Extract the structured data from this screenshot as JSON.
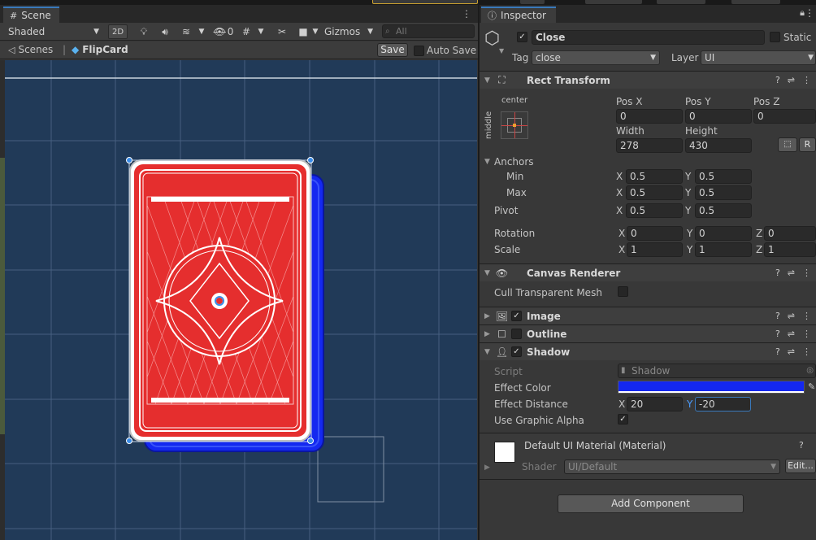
{
  "scene": {
    "tab_label": "Scene",
    "toolbar": {
      "shading_mode": "Shaded",
      "mode_2d": "2D",
      "hidden_count": "0",
      "gizmos_label": "Gizmos",
      "search_placeholder": "All"
    },
    "breadcrumb": {
      "scenes_label": "Scenes",
      "prefab_name": "FlipCard",
      "save_label": "Save",
      "auto_save_label": "Auto Save"
    }
  },
  "inspector": {
    "tab_label": "Inspector",
    "object": {
      "active": true,
      "name": "Close",
      "static_label": "Static",
      "tag_label": "Tag",
      "tag_value": "close",
      "layer_label": "Layer",
      "layer_value": "UI"
    },
    "rect_transform": {
      "title": "Rect Transform",
      "anchor_preset_h": "center",
      "anchor_preset_v": "middle",
      "pos_x_label": "Pos X",
      "pos_y_label": "Pos Y",
      "pos_z_label": "Pos Z",
      "pos_x": "0",
      "pos_y": "0",
      "pos_z": "0",
      "width_label": "Width",
      "height_label": "Height",
      "width": "278",
      "height": "430",
      "r_button": "R",
      "anchors_label": "Anchors",
      "min_label": "Min",
      "max_label": "Max",
      "pivot_label": "Pivot",
      "rotation_label": "Rotation",
      "scale_label": "Scale",
      "x_label": "X",
      "y_label": "Y",
      "z_label": "Z",
      "min_x": "0.5",
      "min_y": "0.5",
      "max_x": "0.5",
      "max_y": "0.5",
      "pivot_x": "0.5",
      "pivot_y": "0.5",
      "rot_x": "0",
      "rot_y": "0",
      "rot_z": "0",
      "scale_x": "1",
      "scale_y": "1",
      "scale_z": "1"
    },
    "canvas_renderer": {
      "title": "Canvas Renderer",
      "cull_label": "Cull Transparent Mesh",
      "cull_checked": false
    },
    "image": {
      "title": "Image",
      "enabled": true
    },
    "outline": {
      "title": "Outline",
      "enabled": false
    },
    "shadow": {
      "title": "Shadow",
      "enabled": true,
      "script_label": "Script",
      "script_value": "Shadow",
      "effect_color_label": "Effect Color",
      "effect_color": "#1428f0",
      "effect_distance_label": "Effect Distance",
      "dist_x": "20",
      "dist_y": "-20",
      "use_alpha_label": "Use Graphic Alpha",
      "use_alpha_checked": true
    },
    "material": {
      "title": "Default UI Material (Material)",
      "shader_label": "Shader",
      "shader_value": "UI/Default",
      "edit_label": "Edit..."
    },
    "add_component_label": "Add Component"
  },
  "colors": {
    "card_red": "#e52e2e",
    "card_shadow_blue": "#1428f0",
    "accent": "#3a79bb",
    "scene_bg": "#213a58"
  }
}
